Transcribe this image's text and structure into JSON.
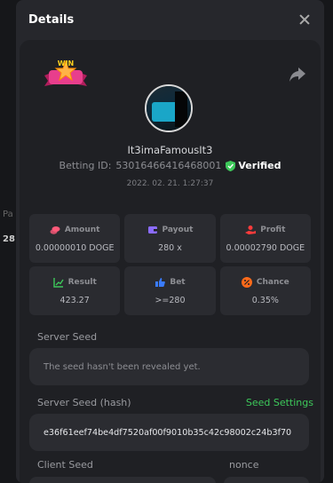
{
  "modal": {
    "title": "Details"
  },
  "player": {
    "username": "It3imaFamousIt3",
    "betting_id_label": "Betting ID:",
    "betting_id": "53016466416468001",
    "verified_label": "Verified",
    "date": "2022. 02. 21. 1:27:37"
  },
  "badge": {
    "text": "WIN"
  },
  "stats": [
    {
      "key": "amount",
      "label": "Amount",
      "value": "0.00000010 DOGE",
      "icon": "coins-icon",
      "color": "#ff5a7a"
    },
    {
      "key": "payout",
      "label": "Payout",
      "value": "280 x",
      "icon": "wallet-icon",
      "color": "#8b6cff"
    },
    {
      "key": "profit",
      "label": "Profit",
      "value": "0.00002790 DOGE",
      "icon": "hand-coin-icon",
      "color": "#ff3b3b"
    },
    {
      "key": "result",
      "label": "Result",
      "value": "423.27",
      "icon": "chart-up-icon",
      "color": "#3dc85a"
    },
    {
      "key": "bet",
      "label": "Bet",
      "value": ">=280",
      "icon": "thumb-icon",
      "color": "#3a7cff"
    },
    {
      "key": "chance",
      "label": "Chance",
      "value": "0.35%",
      "icon": "percent-icon",
      "color": "#ff6a1a"
    }
  ],
  "server_seed": {
    "label": "Server Seed",
    "value": "The seed hasn't been revealed yet."
  },
  "server_seed_hash": {
    "label": "Server Seed (hash)",
    "settings_link": "Seed Settings",
    "value": "e36f61eef74be4df7520af00f9010b35c42c98002c24b3f70"
  },
  "client_seed": {
    "label": "Client Seed"
  },
  "nonce": {
    "label": "nonce"
  },
  "background": {
    "frag_a": "Pa",
    "frag_b": "28"
  }
}
